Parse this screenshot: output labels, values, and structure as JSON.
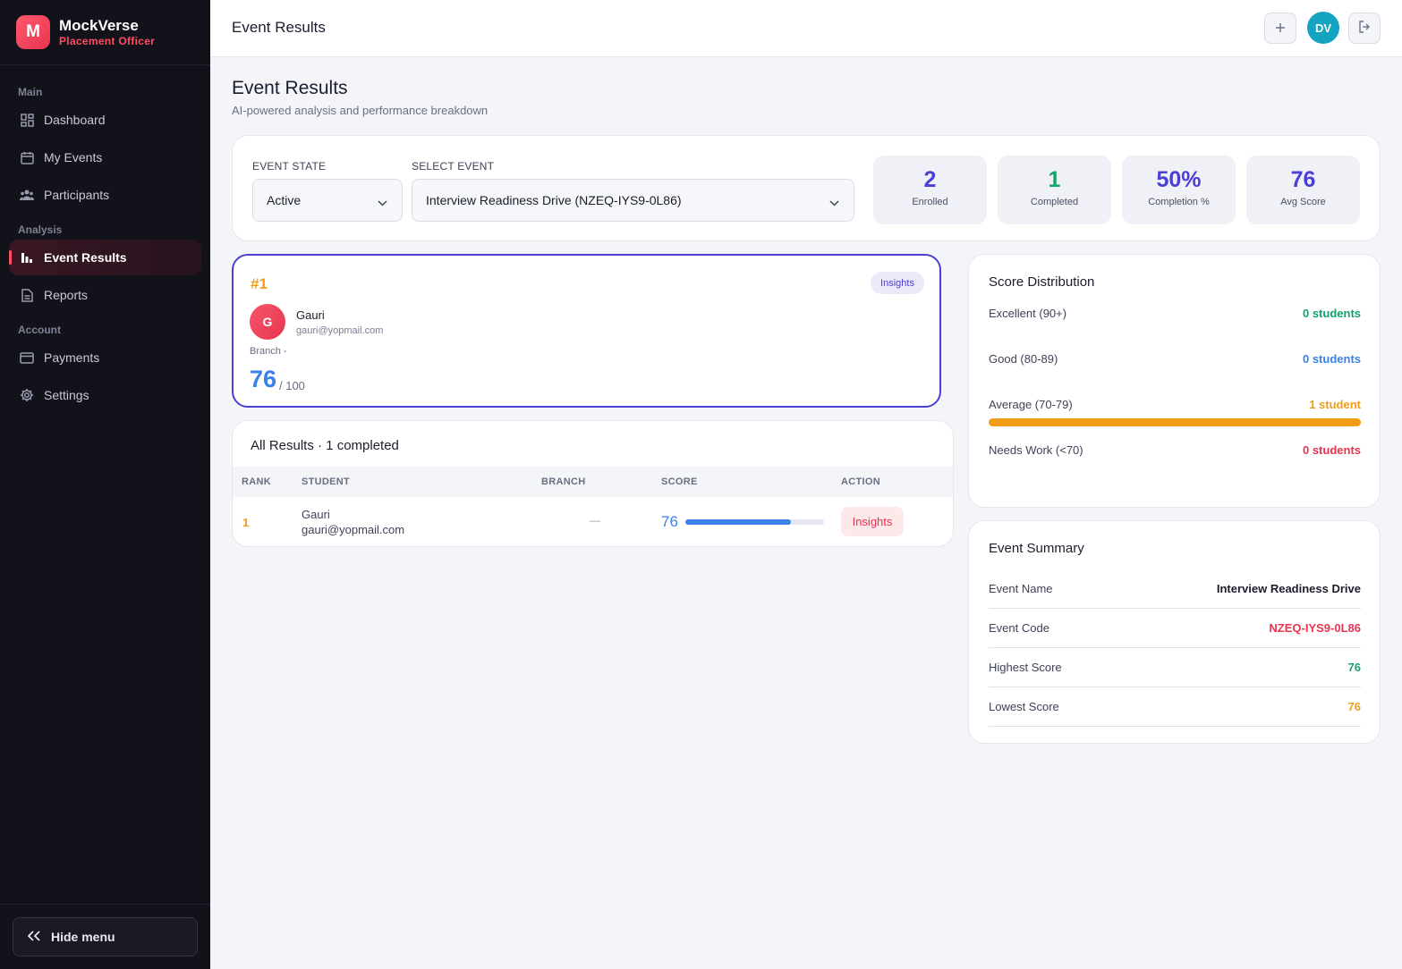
{
  "brand": {
    "logo_letter": "M",
    "name": "MockVerse",
    "role": "Placement Officer"
  },
  "sidebar": {
    "sections": [
      "Main",
      "Analysis",
      "Account"
    ],
    "items": [
      {
        "label": "Dashboard",
        "icon": "dashboard-icon"
      },
      {
        "label": "My Events",
        "icon": "calendar-icon"
      },
      {
        "label": "Participants",
        "icon": "users-icon"
      },
      {
        "label": "Event Results",
        "icon": "bar-chart-icon",
        "active": true
      },
      {
        "label": "Reports",
        "icon": "document-icon"
      },
      {
        "label": "Payments",
        "icon": "credit-card-icon"
      },
      {
        "label": "Settings",
        "icon": "gear-icon"
      }
    ],
    "hide_menu": "Hide menu"
  },
  "topbar": {
    "title": "Event Results",
    "avatar_initials": "DV"
  },
  "page": {
    "title": "Event Results",
    "subtitle": "AI-powered analysis and performance breakdown"
  },
  "filters": {
    "event_state_label": "EVENT STATE",
    "event_state_value": "Active",
    "select_event_label": "SELECT EVENT",
    "select_event_value": "Interview Readiness Drive (NZEQ-IYS9-0L86)"
  },
  "stats": [
    {
      "value": "2",
      "label": "Enrolled",
      "color": "#4b3fd4"
    },
    {
      "value": "1",
      "label": "Completed",
      "color": "#14a36b"
    },
    {
      "value": "50%",
      "label": "Completion %",
      "color": "#4b3fd4"
    },
    {
      "value": "76",
      "label": "Avg Score",
      "color": "#4b3fd4"
    }
  ],
  "top_performer": {
    "rank": "#1",
    "insights_label": "Insights",
    "avatar_letter": "G",
    "name": "Gauri",
    "email": "gauri@yopmail.com",
    "branch": "Branch -",
    "score": "76",
    "score_max": "/ 100"
  },
  "results": {
    "title": "All Results · 1 completed",
    "columns": [
      "RANK",
      "STUDENT",
      "BRANCH",
      "SCORE",
      "ACTION"
    ],
    "rows": [
      {
        "rank": "1",
        "name": "Gauri",
        "email": "gauri@yopmail.com",
        "branch": "—",
        "score": "76",
        "score_fraction": 0.76,
        "action": "Insights"
      }
    ]
  },
  "distribution": {
    "title": "Score Distribution",
    "rows": [
      {
        "label": "Excellent (90+)",
        "value": "0 students",
        "color": "#14a36b",
        "fraction": 0
      },
      {
        "label": "Good (80-89)",
        "value": "0 students",
        "color": "#3b82e8",
        "fraction": 0
      },
      {
        "label": "Average (70-79)",
        "value": "1 student",
        "color": "#f29b16",
        "fraction": 1
      },
      {
        "label": "Needs Work (<70)",
        "value": "0 students",
        "color": "#e8344f",
        "fraction": 0
      }
    ]
  },
  "summary": {
    "title": "Event Summary",
    "rows": [
      {
        "label": "Event Name",
        "value": "Interview Readiness Drive",
        "color": "#1b1d2e"
      },
      {
        "label": "Event Code",
        "value": "NZEQ-IYS9-0L86",
        "color": "#e8344f"
      },
      {
        "label": "Highest Score",
        "value": "76",
        "color": "#14a36b"
      },
      {
        "label": "Lowest Score",
        "value": "76",
        "color": "#f29b16"
      }
    ]
  }
}
